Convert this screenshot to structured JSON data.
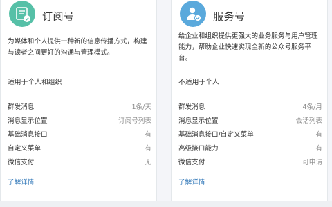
{
  "subscription": {
    "title": "订阅号",
    "icon": "subscription-doc-icon",
    "icon_color": "#56c0a7",
    "description": "为媒体和个人提供一种新的信息传播方式，构建与读者之间更好的沟通与管理模式。",
    "suitable": "适用于个人和组织",
    "features": [
      {
        "name": "群发消息",
        "value": "1条/天"
      },
      {
        "name": "消息显示位置",
        "value": "订阅号列表"
      },
      {
        "name": "基础消息接口",
        "value": "有"
      },
      {
        "name": "自定义菜单",
        "value": "有"
      },
      {
        "name": "微信支付",
        "value": "无"
      }
    ],
    "learn_more": "了解详情"
  },
  "service": {
    "title": "服务号",
    "icon": "service-person-icon",
    "icon_color": "#5aa9dc",
    "description": "给企业和组织提供更强大的业务服务与用户管理能力，帮助企业快速实现全新的公众号服务平台。",
    "suitable": "不适用于个人",
    "features": [
      {
        "name": "群发消息",
        "value": "4条/月"
      },
      {
        "name": "消息显示位置",
        "value": "会话列表"
      },
      {
        "name": "基础消息接口/自定义菜单",
        "value": "有"
      },
      {
        "name": "高级接口能力",
        "value": "有"
      },
      {
        "name": "微信支付",
        "value": "可申请"
      }
    ],
    "learn_more": "了解详情"
  },
  "colors": {
    "link": "#2d75b7",
    "text": "#353535",
    "muted": "#8d8d8d",
    "background": "#f4f5f9"
  }
}
